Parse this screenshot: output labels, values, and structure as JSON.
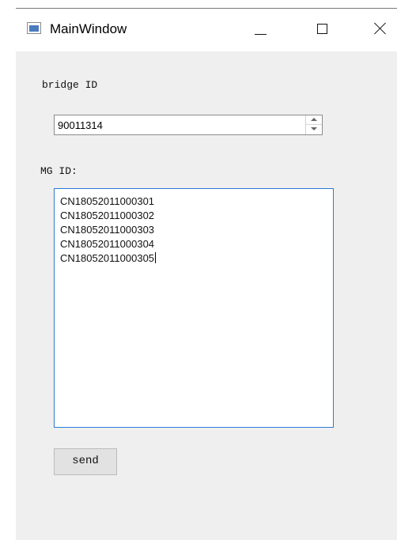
{
  "window": {
    "title": "MainWindow"
  },
  "icons": {
    "app_icon": "window-icon",
    "minimize": "minimize-icon",
    "maximize": "maximize-icon",
    "close": "close-icon",
    "spin_up": "chevron-up-icon",
    "spin_down": "chevron-down-icon"
  },
  "form": {
    "bridge_label": "bridge ID",
    "bridge_value": "90011314",
    "mg_label": "MG ID:",
    "mg_lines": [
      "CN18052011000301",
      "CN18052011000302",
      "CN18052011000303",
      "CN18052011000304",
      "CN18052011000305"
    ],
    "send_label": "send"
  },
  "colors": {
    "titlebar_bg": "#ffffff",
    "window_bg": "#efefef",
    "focus_border": "#2b79d7",
    "button_bg": "#e2e2e2",
    "spinbox_border": "#8b8b8b"
  }
}
